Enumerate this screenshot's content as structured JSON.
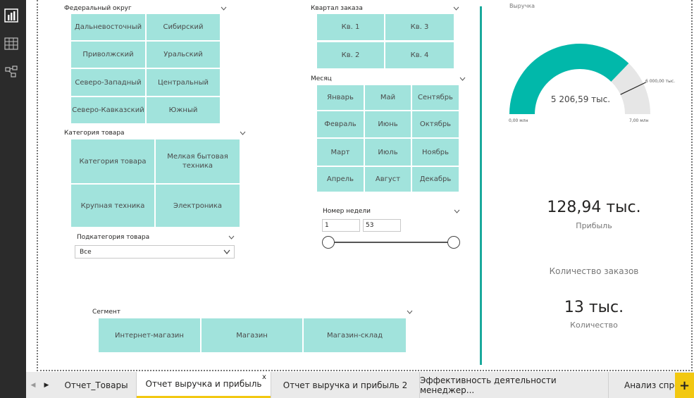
{
  "rail": {
    "items": [
      {
        "icon": "report-view-icon",
        "active": true
      },
      {
        "icon": "data-view-icon",
        "active": false
      },
      {
        "icon": "relationships-view-icon",
        "active": false
      }
    ]
  },
  "slicers": {
    "federal_district": {
      "title": "Федеральный округ",
      "items": [
        "Дальневосточный",
        "Сибирский",
        "Приволжский",
        "Уральский",
        "Северо-Западный",
        "Центральный",
        "Северо-Кавказский",
        "Южный"
      ]
    },
    "category": {
      "title": "Категория товара",
      "items": [
        "Категория товара",
        "Мелкая бытовая техника",
        "Крупная техника",
        "Электроника"
      ]
    },
    "subcategory": {
      "title": "Подкатегория товара",
      "selected": "Все"
    },
    "quarter": {
      "title": "Квартал заказа",
      "items": [
        "Кв. 1",
        "Кв. 3",
        "Кв. 2",
        "Кв. 4"
      ]
    },
    "month": {
      "title": "Месяц",
      "items": [
        "Январь",
        "Май",
        "Сентябрь",
        "Февраль",
        "Июнь",
        "Октябрь",
        "Март",
        "Июль",
        "Ноябрь",
        "Апрель",
        "Август",
        "Декабрь"
      ]
    },
    "week": {
      "title": "Номер недели",
      "from": "1",
      "to": "53"
    },
    "segment": {
      "title": "Сегмент",
      "items": [
        "Интернет-магазин",
        "Магазин",
        "Магазин-склад"
      ]
    }
  },
  "gauge": {
    "title": "Выручка",
    "value_label": "5 206,59 тыс.",
    "min_label": "0,00 млн",
    "max_label": "7,00 млн",
    "target_label": "6 000,00 тыс.",
    "value_fraction": 0.7438,
    "target_fraction": 0.8571,
    "fill_color": "#01b8aa",
    "track_color": "#e6e6e6"
  },
  "cards": {
    "profit": {
      "value": "128,94 тыс.",
      "label": "Прибыль"
    },
    "orders_title": "Количество заказов",
    "orders": {
      "value": "13 тыс.",
      "label": "Количество"
    }
  },
  "tabs": {
    "items": [
      "Отчет_Товары",
      "Отчет выручка и прибыль",
      "Отчет выручка и прибыль 2",
      "Эффективность деятельности менеджер...",
      "Анализ спро"
    ],
    "active_index": 1,
    "close_label": "x",
    "add_label": "+",
    "prev_label": "◀",
    "next_label": "▶"
  },
  "colors": {
    "tile": "#a1e3dc",
    "accent_divider": "#1aa99c",
    "tab_accent": "#f2c811"
  }
}
